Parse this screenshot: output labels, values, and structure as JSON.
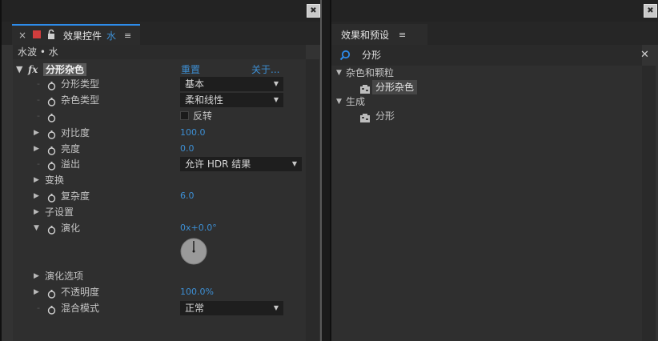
{
  "effect_controls": {
    "tab": {
      "title": "效果控件",
      "layer_name": "水"
    },
    "layer_line": "水波 • 水",
    "effect": {
      "name": "分形杂色",
      "reset_label": "重置",
      "about_label": "关于..."
    },
    "params": {
      "fractal_type": {
        "label": "分形类型",
        "value": "基本"
      },
      "noise_type": {
        "label": "杂色类型",
        "value": "柔和线性"
      },
      "invert": {
        "label": "反转",
        "checked": false
      },
      "contrast": {
        "label": "对比度",
        "value": "100.0"
      },
      "brightness": {
        "label": "亮度",
        "value": "0.0"
      },
      "overflow": {
        "label": "溢出",
        "value": "允许 HDR 结果"
      },
      "transform": {
        "label": "变换"
      },
      "complexity": {
        "label": "复杂度",
        "value": "6.0"
      },
      "sub_settings": {
        "label": "子设置"
      },
      "evolution": {
        "label": "演化",
        "value": "0x+0.0°",
        "angle_degrees": 0
      },
      "evolution_options": {
        "label": "演化选项"
      },
      "opacity": {
        "label": "不透明度",
        "value": "100.0%"
      },
      "blending_mode": {
        "label": "混合模式",
        "value": "正常"
      }
    }
  },
  "effects_presets": {
    "tab": {
      "title": "效果和预设"
    },
    "search": {
      "value": "分形"
    },
    "tree": [
      {
        "category": "杂色和颗粒",
        "items": [
          "分形杂色"
        ]
      },
      {
        "category": "生成",
        "items": [
          "分形"
        ]
      }
    ]
  },
  "colors": {
    "accent_blue": "#2d8ceb",
    "value_blue": "#3d8fd4",
    "effect_bg": "#333333"
  }
}
